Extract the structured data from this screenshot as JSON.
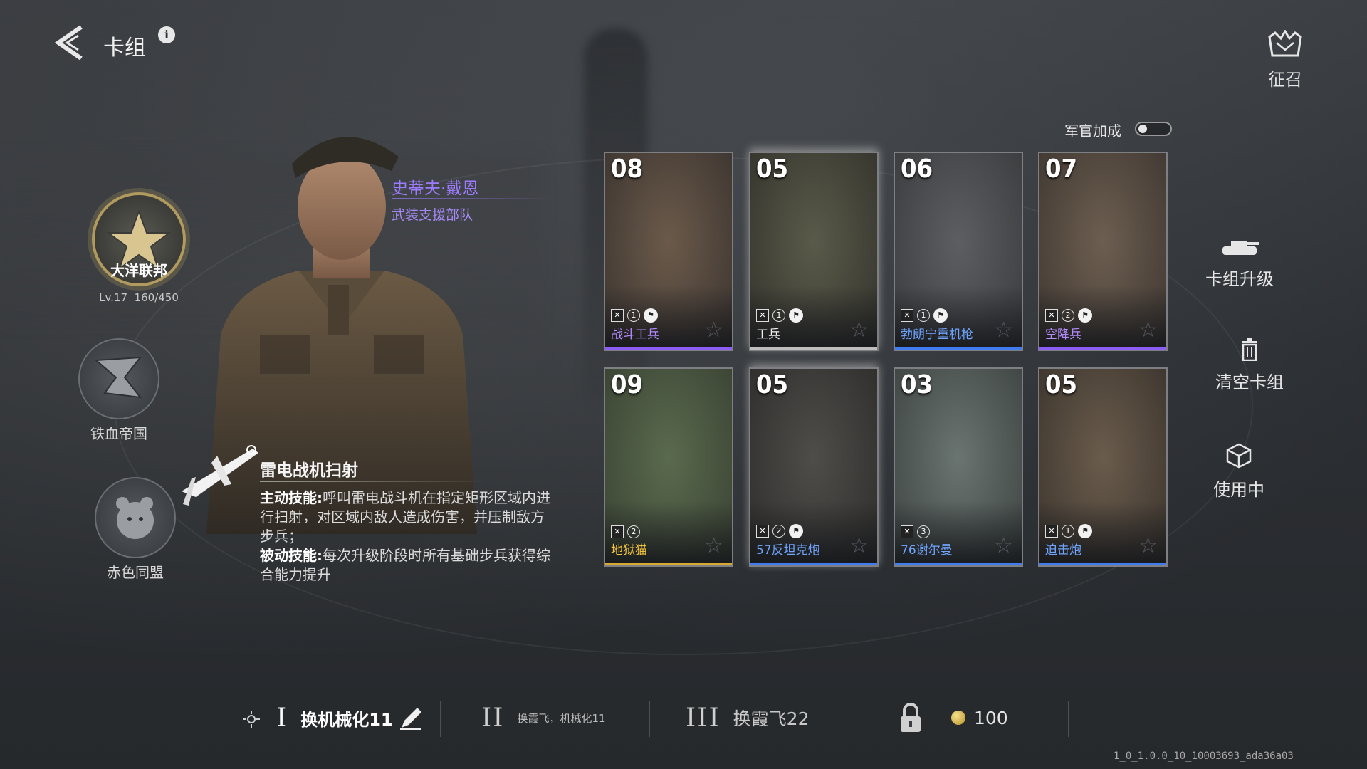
{
  "header": {
    "title": "卡组",
    "info_icon": "i",
    "recruit_label": "征召"
  },
  "factions": [
    {
      "name": "大洋联邦",
      "level": "Lv.17",
      "xp": "160/450",
      "selected": true
    },
    {
      "name": "铁血帝国",
      "selected": false
    },
    {
      "name": "赤色同盟",
      "selected": false
    }
  ],
  "commander": {
    "name": "史蒂夫·戴恩",
    "unit": "武装支援部队",
    "skill_title": "雷电战机扫射",
    "active_label": "主动技能:",
    "active_text": "呼叫雷电战斗机在指定矩形区域内进行扫射，对区域内敌人造成伤害，并压制敌方步兵；",
    "passive_label": "被动技能:",
    "passive_text": "每次升级阶段时所有基础步兵获得综合能力提升"
  },
  "officer_bonus": {
    "label": "军官加成",
    "on": false
  },
  "cards": [
    {
      "cost": "08",
      "name": "战斗工兵",
      "count": "1",
      "flag": true,
      "rarity": "purple",
      "type_icon": "engineer-icon"
    },
    {
      "cost": "05",
      "name": "工兵",
      "count": "1",
      "flag": true,
      "rarity": "white",
      "type_icon": "engineer-icon"
    },
    {
      "cost": "06",
      "name": "勃朗宁重机枪",
      "count": "1",
      "flag": true,
      "rarity": "blue",
      "type_icon": "machine-gun-icon"
    },
    {
      "cost": "07",
      "name": "空降兵",
      "count": "2",
      "flag": true,
      "rarity": "purple",
      "type_icon": "paratrooper-icon"
    },
    {
      "cost": "09",
      "name": "地狱猫",
      "count": "2",
      "flag": false,
      "rarity": "gold",
      "type_icon": "tank-destroyer-icon"
    },
    {
      "cost": "05",
      "name": "57反坦克炮",
      "count": "2",
      "flag": true,
      "rarity": "blue",
      "type_icon": "artillery-icon"
    },
    {
      "cost": "03",
      "name": "76谢尔曼",
      "count": "3",
      "flag": false,
      "rarity": "blue",
      "type_icon": "tank-icon"
    },
    {
      "cost": "05",
      "name": "迫击炮",
      "count": "1",
      "flag": true,
      "rarity": "blue",
      "type_icon": "mortar-icon"
    }
  ],
  "actions": {
    "upgrade": "卡组升级",
    "clear": "清空卡组",
    "in_use": "使用中"
  },
  "deck_slots": [
    {
      "roman": "I",
      "name": "换机械化11"
    },
    {
      "roman": "II",
      "name": "换霞飞，机械化11"
    },
    {
      "roman": "III",
      "name": "换霞飞22"
    }
  ],
  "gold": "100",
  "version": "1_0_1.0.0_10_10003693_ada36a03"
}
